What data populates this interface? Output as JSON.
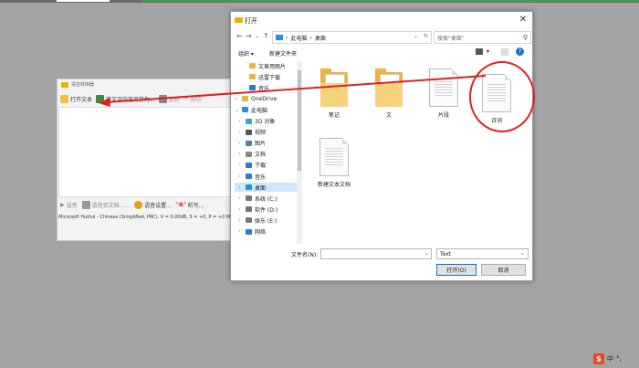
{
  "app": {
    "title": "语音转换器",
    "toolbar": {
      "open_text": "打开文本",
      "save_as": "将文字内容另存为...",
      "copy": "复制",
      "cut": "剪切"
    },
    "bottombar": {
      "read": "语音",
      "save_to_audio": "语音到文档......",
      "voice_settings": "语音设置...",
      "read_label": "\"A\"",
      "dictation": "听写..."
    },
    "status": "Microsoft Huihui - Chinese (Simplified, PRC),  V = 0.00dB,  S = +0,  P = +0    Microsoft"
  },
  "dialog": {
    "title": "打开",
    "address": [
      "此电脑",
      "桌面"
    ],
    "search_placeholder": "搜索\"桌面\"",
    "organize": "组织 ▾",
    "new_folder": "新建文件夹",
    "sidebar": [
      {
        "label": "文章用图片",
        "icon": "folder-icon",
        "selected": false,
        "expand": false
      },
      {
        "label": "迅雷下载",
        "icon": "folder-icon",
        "selected": false,
        "expand": false
      },
      {
        "label": "音乐",
        "icon": "music-icon",
        "selected": false,
        "expand": false
      },
      {
        "label": "OneDrive",
        "icon": "cloud-icon",
        "selected": false,
        "expand": true
      },
      {
        "label": "此电脑",
        "icon": "pc-icon",
        "selected": false,
        "expand": true
      },
      {
        "label": "3D 对象",
        "icon": "cube-icon",
        "selected": false,
        "expand": true
      },
      {
        "label": "视频",
        "icon": "video-icon",
        "selected": false,
        "expand": true
      },
      {
        "label": "图片",
        "icon": "picture-icon",
        "selected": false,
        "expand": true
      },
      {
        "label": "文档",
        "icon": "document-icon",
        "selected": false,
        "expand": true
      },
      {
        "label": "下载",
        "icon": "download-icon",
        "selected": false,
        "expand": true
      },
      {
        "label": "音乐",
        "icon": "music-icon",
        "selected": false,
        "expand": true
      },
      {
        "label": "桌面",
        "icon": "desktop-icon",
        "selected": true,
        "expand": true
      },
      {
        "label": "系统 (C:)",
        "icon": "drive-icon",
        "selected": false,
        "expand": true
      },
      {
        "label": "软件 (D:)",
        "icon": "drive-icon",
        "selected": false,
        "expand": true
      },
      {
        "label": "娱乐 (E:)",
        "icon": "drive-icon",
        "selected": false,
        "expand": true
      },
      {
        "label": "网络",
        "icon": "network-icon",
        "selected": false,
        "expand": true
      }
    ],
    "files": [
      {
        "label": "笔记",
        "kind": "folder"
      },
      {
        "label": "文",
        "kind": "folder"
      },
      {
        "label": "片段",
        "kind": "document"
      },
      {
        "label": "诗词",
        "kind": "document"
      },
      {
        "label": "新建文本文档",
        "kind": "document"
      }
    ],
    "filename_label": "文件名(N):",
    "filename_value": "",
    "filetype": "Text",
    "open_button": "打开(O)",
    "cancel_button": "取消"
  },
  "tray": {
    "ime": "中"
  },
  "colors": {
    "accent": "#0078d7",
    "annotation": "#e02020",
    "folder": "#e8b543"
  }
}
